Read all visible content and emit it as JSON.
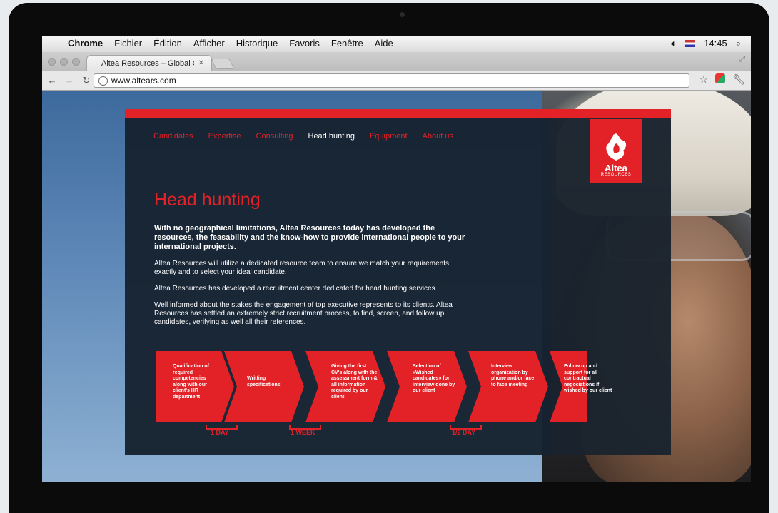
{
  "menubar": {
    "app": "Chrome",
    "items": [
      "Fichier",
      "Édition",
      "Afficher",
      "Historique",
      "Favoris",
      "Fenêtre",
      "Aide"
    ],
    "time": "14:45"
  },
  "browser": {
    "tab_title": "Altea Resources – Global Oil",
    "url": "www.altears.com"
  },
  "site": {
    "nav": [
      {
        "label": "Candidates",
        "active": false
      },
      {
        "label": "Expertise",
        "active": false
      },
      {
        "label": "Consulting",
        "active": false
      },
      {
        "label": "Head hunting",
        "active": true
      },
      {
        "label": "Equipment",
        "active": false
      },
      {
        "label": "About us",
        "active": false
      }
    ],
    "logo": {
      "name": "Altea",
      "sub": "RESOURCES"
    },
    "title": "Head hunting",
    "lead": "With no geographical limitations, Altea Resources today has developed the resources, the feasability and the know-how to provide international people to your international projects.",
    "paragraphs": [
      "Altea Resources will utilize a dedicated resource team to ensure we match your requirements exactly and to select your ideal candidate.",
      "Altea Resources has developed a recruitment center dedicated for head hunting services.",
      "Well informed about the stakes  the engagement of top executive represents to its clients. Altea Resources has settled an extremely strict recruitment process, to find, screen, and follow up candidates, verifying  as well all their references."
    ],
    "steps": [
      "Qualification of required competencies along with our client's HR department",
      "Writting specifications",
      "Giving the first CV's along with the assessment form & all information required by our client",
      "Selection of «Wished candidates» for interview done by our client",
      "Interview organization by phone and/or face to face meeting",
      "Follow up and support for all contractual negociations if wished by our client"
    ],
    "durations": [
      "1 DAY",
      "1 WEEK",
      "1/2 DAY"
    ]
  },
  "colors": {
    "accent": "#e32227",
    "panel": "#16222f"
  }
}
